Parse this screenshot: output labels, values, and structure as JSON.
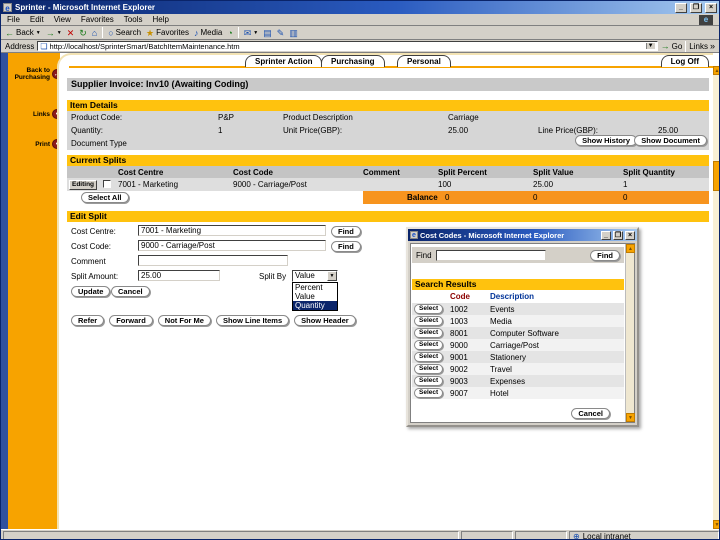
{
  "colors": {
    "accent_orange": "#F7A300",
    "gold_bar": "#FFC20E",
    "balance_orange": "#F7941E",
    "titlebar_blue": "#0A246A",
    "navy_strip": "#31519E",
    "sidebar_icon_red": "#8B1A1A"
  },
  "icons": {
    "app": "e",
    "ie_logo": "e",
    "page": "❏",
    "back": "←",
    "forward": "→",
    "stop": "✕",
    "refresh": "↻",
    "home": "⌂",
    "search": "○",
    "favorites": "★",
    "media": "♪",
    "history": "◔",
    "mail": "✉",
    "print": "▤",
    "edit": "✎",
    "discuss": "▥",
    "dropdown": "▼",
    "go": "→",
    "links_chevron": "»",
    "minimize": "_",
    "maximize": "❐",
    "restore": "❐",
    "close": "×",
    "scroll_up": "▲",
    "scroll_down": "▼",
    "globe": "⊕",
    "sidebar_back": "←",
    "sidebar_links": "•",
    "sidebar_print": "•"
  },
  "chrome": {
    "title": "Sprinter - Microsoft Internet Explorer",
    "menus": [
      "File",
      "Edit",
      "View",
      "Favorites",
      "Tools",
      "Help"
    ],
    "toolbar": {
      "back": "Back",
      "search": "Search",
      "favorites": "Favorites",
      "media": "Media"
    },
    "address": {
      "label": "Address",
      "url": "http://localhost/SprinterSmart/BatchItemMaintenance.htm",
      "go": "Go",
      "links": "Links"
    },
    "status": {
      "zone": "Local intranet"
    }
  },
  "nav": {
    "tabs": [
      "Sprinter Action",
      "Purchasing",
      "Personal"
    ],
    "logoff": "Log Off"
  },
  "sidebar": {
    "items": [
      {
        "label": "Back to Purchasing"
      },
      {
        "label": "Links"
      },
      {
        "label": "Print"
      }
    ]
  },
  "page": {
    "title": "Supplier Invoice: Inv10 (Awaiting Coding)",
    "item_details": {
      "heading": "Item Details",
      "product_code_label": "Product Code:",
      "product_code": "P&P",
      "product_description_label": "Product Description",
      "product_description": "Carriage",
      "quantity_label": "Quantity:",
      "quantity": "1",
      "unit_price_label": "Unit Price(GBP):",
      "unit_price": "25.00",
      "line_price_label": "Line Price(GBP):",
      "line_price": "25.00",
      "document_type_label": "Document Type",
      "show_history_button": "Show History",
      "show_document_button": "Show Document"
    },
    "current_splits": {
      "heading": "Current Splits",
      "columns": {
        "cost_centre": "Cost Centre",
        "cost_code": "Cost Code",
        "comment": "Comment",
        "split_percent": "Split Percent",
        "split_value": "Split Value",
        "split_quantity": "Split Quantity"
      },
      "row": {
        "edit_button": "Editing",
        "cost_centre": "7001 - Marketing",
        "cost_code": "9000 - Carriage/Post",
        "comment": "",
        "split_percent": "100",
        "split_value": "25.00",
        "split_quantity": "1"
      },
      "select_all_button": "Select All",
      "balance_label": "Balance",
      "balance_percent": "0",
      "balance_value": "0",
      "balance_quantity": "0"
    },
    "edit_split": {
      "heading": "Edit Split",
      "cost_centre_label": "Cost Centre:",
      "cost_centre_value": "7001 - Marketing",
      "cost_code_label": "Cost Code:",
      "cost_code_value": "9000 - Carriage/Post",
      "comment_label": "Comment",
      "comment_value": "",
      "split_amount_label": "Split Amount:",
      "split_amount_value": "25.00",
      "split_by_label": "Split By",
      "split_by_value": "Value",
      "split_by_options": [
        "Percent",
        "Value",
        "Quantity"
      ],
      "find_button": "Find",
      "update_button": "Update",
      "cancel_button": "Cancel"
    },
    "actions": {
      "refer": "Refer",
      "forward": "Forward",
      "not_for_me": "Not For Me",
      "show_line_items": "Show Line Items",
      "show_header": "Show Header"
    }
  },
  "popup": {
    "title": "Cost Codes - Microsoft Internet Explorer",
    "find_label": "Find",
    "search_value": "",
    "find_button": "Find",
    "results_heading": "Search Results",
    "columns": {
      "code": "Code",
      "description": "Description"
    },
    "select_button": "Select",
    "rows": [
      {
        "code": "1002",
        "description": "Events"
      },
      {
        "code": "1003",
        "description": "Media"
      },
      {
        "code": "8001",
        "description": "Computer Software"
      },
      {
        "code": "9000",
        "description": "Carriage/Post"
      },
      {
        "code": "9001",
        "description": "Stationery"
      },
      {
        "code": "9002",
        "description": "Travel"
      },
      {
        "code": "9003",
        "description": "Expenses"
      },
      {
        "code": "9007",
        "description": "Hotel"
      }
    ],
    "cancel_button": "Cancel"
  }
}
